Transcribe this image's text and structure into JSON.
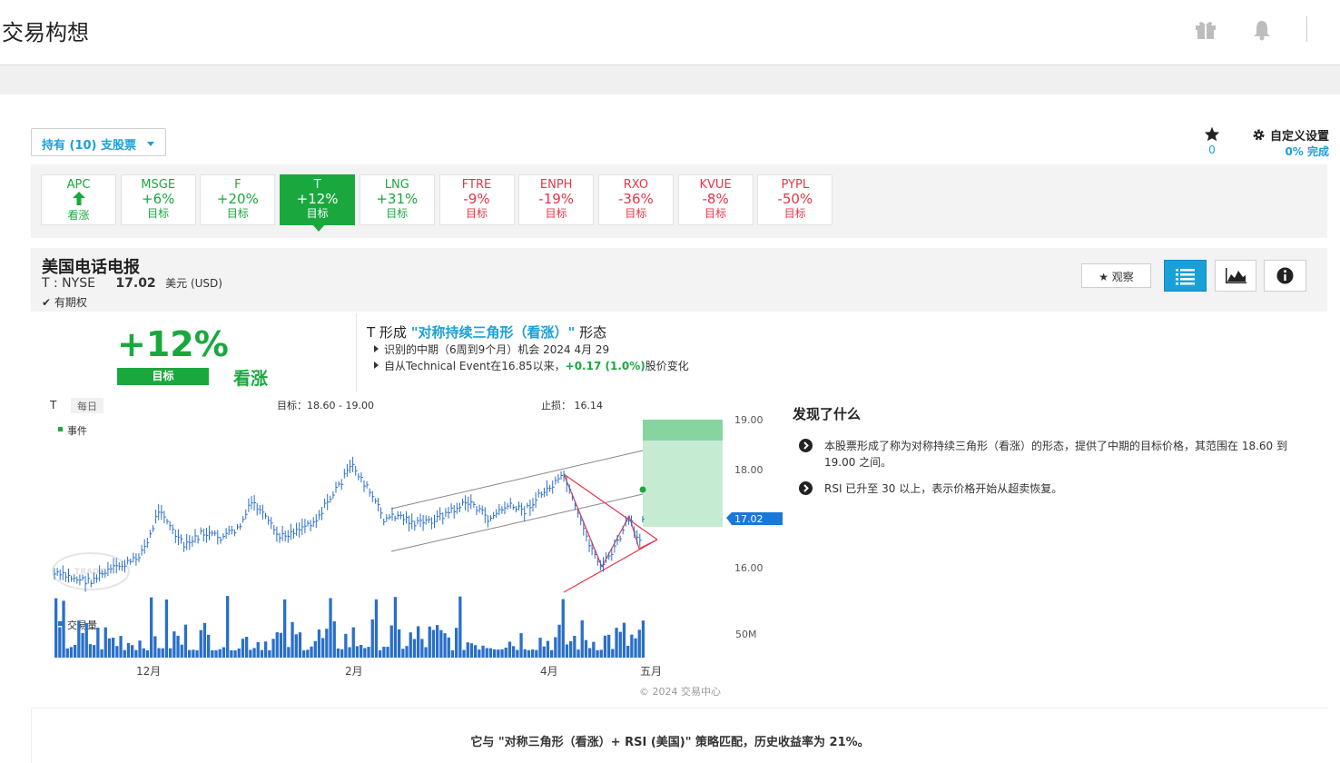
{
  "header": {
    "title": "交易构想",
    "gift_icon": "gift-icon",
    "bell_icon": "bell-icon"
  },
  "toolbar": {
    "holdings_label": "持有 (10) 支股票",
    "star_count": "0",
    "custom_label": "自定义设置",
    "custom_pct": "0% 完成"
  },
  "tiles": [
    {
      "symbol": "APC",
      "value": "🡅",
      "sub": "看涨",
      "color": "g"
    },
    {
      "symbol": "MSGE",
      "value": "+6%",
      "sub": "目标",
      "color": "g"
    },
    {
      "symbol": "F",
      "value": "+20%",
      "sub": "目标",
      "color": "g"
    },
    {
      "symbol": "T",
      "value": "+12%",
      "sub": "目标",
      "color": "active"
    },
    {
      "symbol": "LNG",
      "value": "+31%",
      "sub": "目标",
      "color": "g"
    },
    {
      "symbol": "FTRE",
      "value": "-9%",
      "sub": "目标",
      "color": "r"
    },
    {
      "symbol": "ENPH",
      "value": "-19%",
      "sub": "目标",
      "color": "r"
    },
    {
      "symbol": "RXO",
      "value": "-36%",
      "sub": "目标",
      "color": "r"
    },
    {
      "symbol": "KVUE",
      "value": "-8%",
      "sub": "目标",
      "color": "r"
    },
    {
      "symbol": "PYPL",
      "value": "-50%",
      "sub": "目标",
      "color": "r"
    }
  ],
  "stock": {
    "name": "美国电话电报",
    "exchange": "T : NYSE",
    "price": "17.02",
    "currency": "美元 (USD)",
    "options": "有期权",
    "watch_label": "观察"
  },
  "summary": {
    "pct": "+12%",
    "target_label": "目标",
    "direction": "看涨",
    "pattern_prefix": "T 形成 ",
    "pattern_name": "\"对称持续三角形（看涨）\"",
    "pattern_suffix": " 形态",
    "bullet1": "识别的中期（6周到9个月）机会 2024 4月 29",
    "bullet2_pre": "自从Technical Event在16.85以来，",
    "bullet2_change": "+0.17 (1.0%)",
    "bullet2_post": "股价变化"
  },
  "chart": {
    "symbol": "T",
    "interval": "每日",
    "target_text": "目标：18.60 - 19.00",
    "stop_text": "止损：  16.14",
    "event_legend": "事件",
    "volume_legend": "交易量",
    "current_price_tag": "17.02",
    "copyright": "© 2024 交易中心",
    "y_labels": [
      "19.00",
      "18.00",
      "17.00",
      "16.00"
    ],
    "volume_label": "50M",
    "x_labels": [
      "12月",
      "2月",
      "4月",
      "五月"
    ]
  },
  "findings": {
    "title": "发现了什么",
    "items": [
      "本股票形成了称为对称持续三角形（看涨）的形态，提供了中期的目标价格，其范围在 18.60 到 19.00 之间。",
      "RSI 已升至 30 以上，表示价格开始从超卖恢复。"
    ]
  },
  "footer": {
    "strategy_text": "它与 \"对称三角形（看涨）+ RSI (美国)\" 策略匹配，历史收益率为 21%。"
  },
  "colors": {
    "green": "#1aa83e",
    "red": "#e8344a",
    "blue": "#1aa0d8"
  }
}
